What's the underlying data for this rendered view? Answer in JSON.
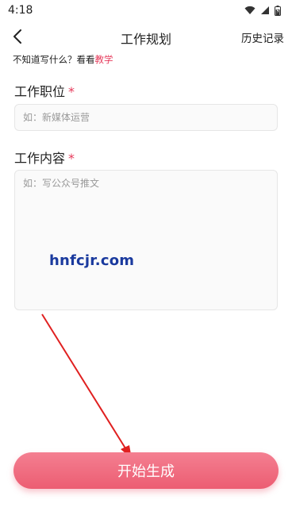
{
  "status_bar": {
    "time": "4:18"
  },
  "header": {
    "title": "工作规划",
    "history_label": "历史记录"
  },
  "hint": {
    "text": "不知道写什么？看看",
    "link": "教学"
  },
  "form": {
    "job_label": "工作职位",
    "job_placeholder": "如：新媒体运营",
    "content_label": "工作内容",
    "content_placeholder": "如：写公众号推文",
    "required_mark": "*"
  },
  "watermark": {
    "text": "hnfcjr.com"
  },
  "actions": {
    "generate_label": "开始生成"
  },
  "colors": {
    "accent": "#e6395a",
    "button": "#ec5d72",
    "annotation_arrow": "#e02020"
  }
}
